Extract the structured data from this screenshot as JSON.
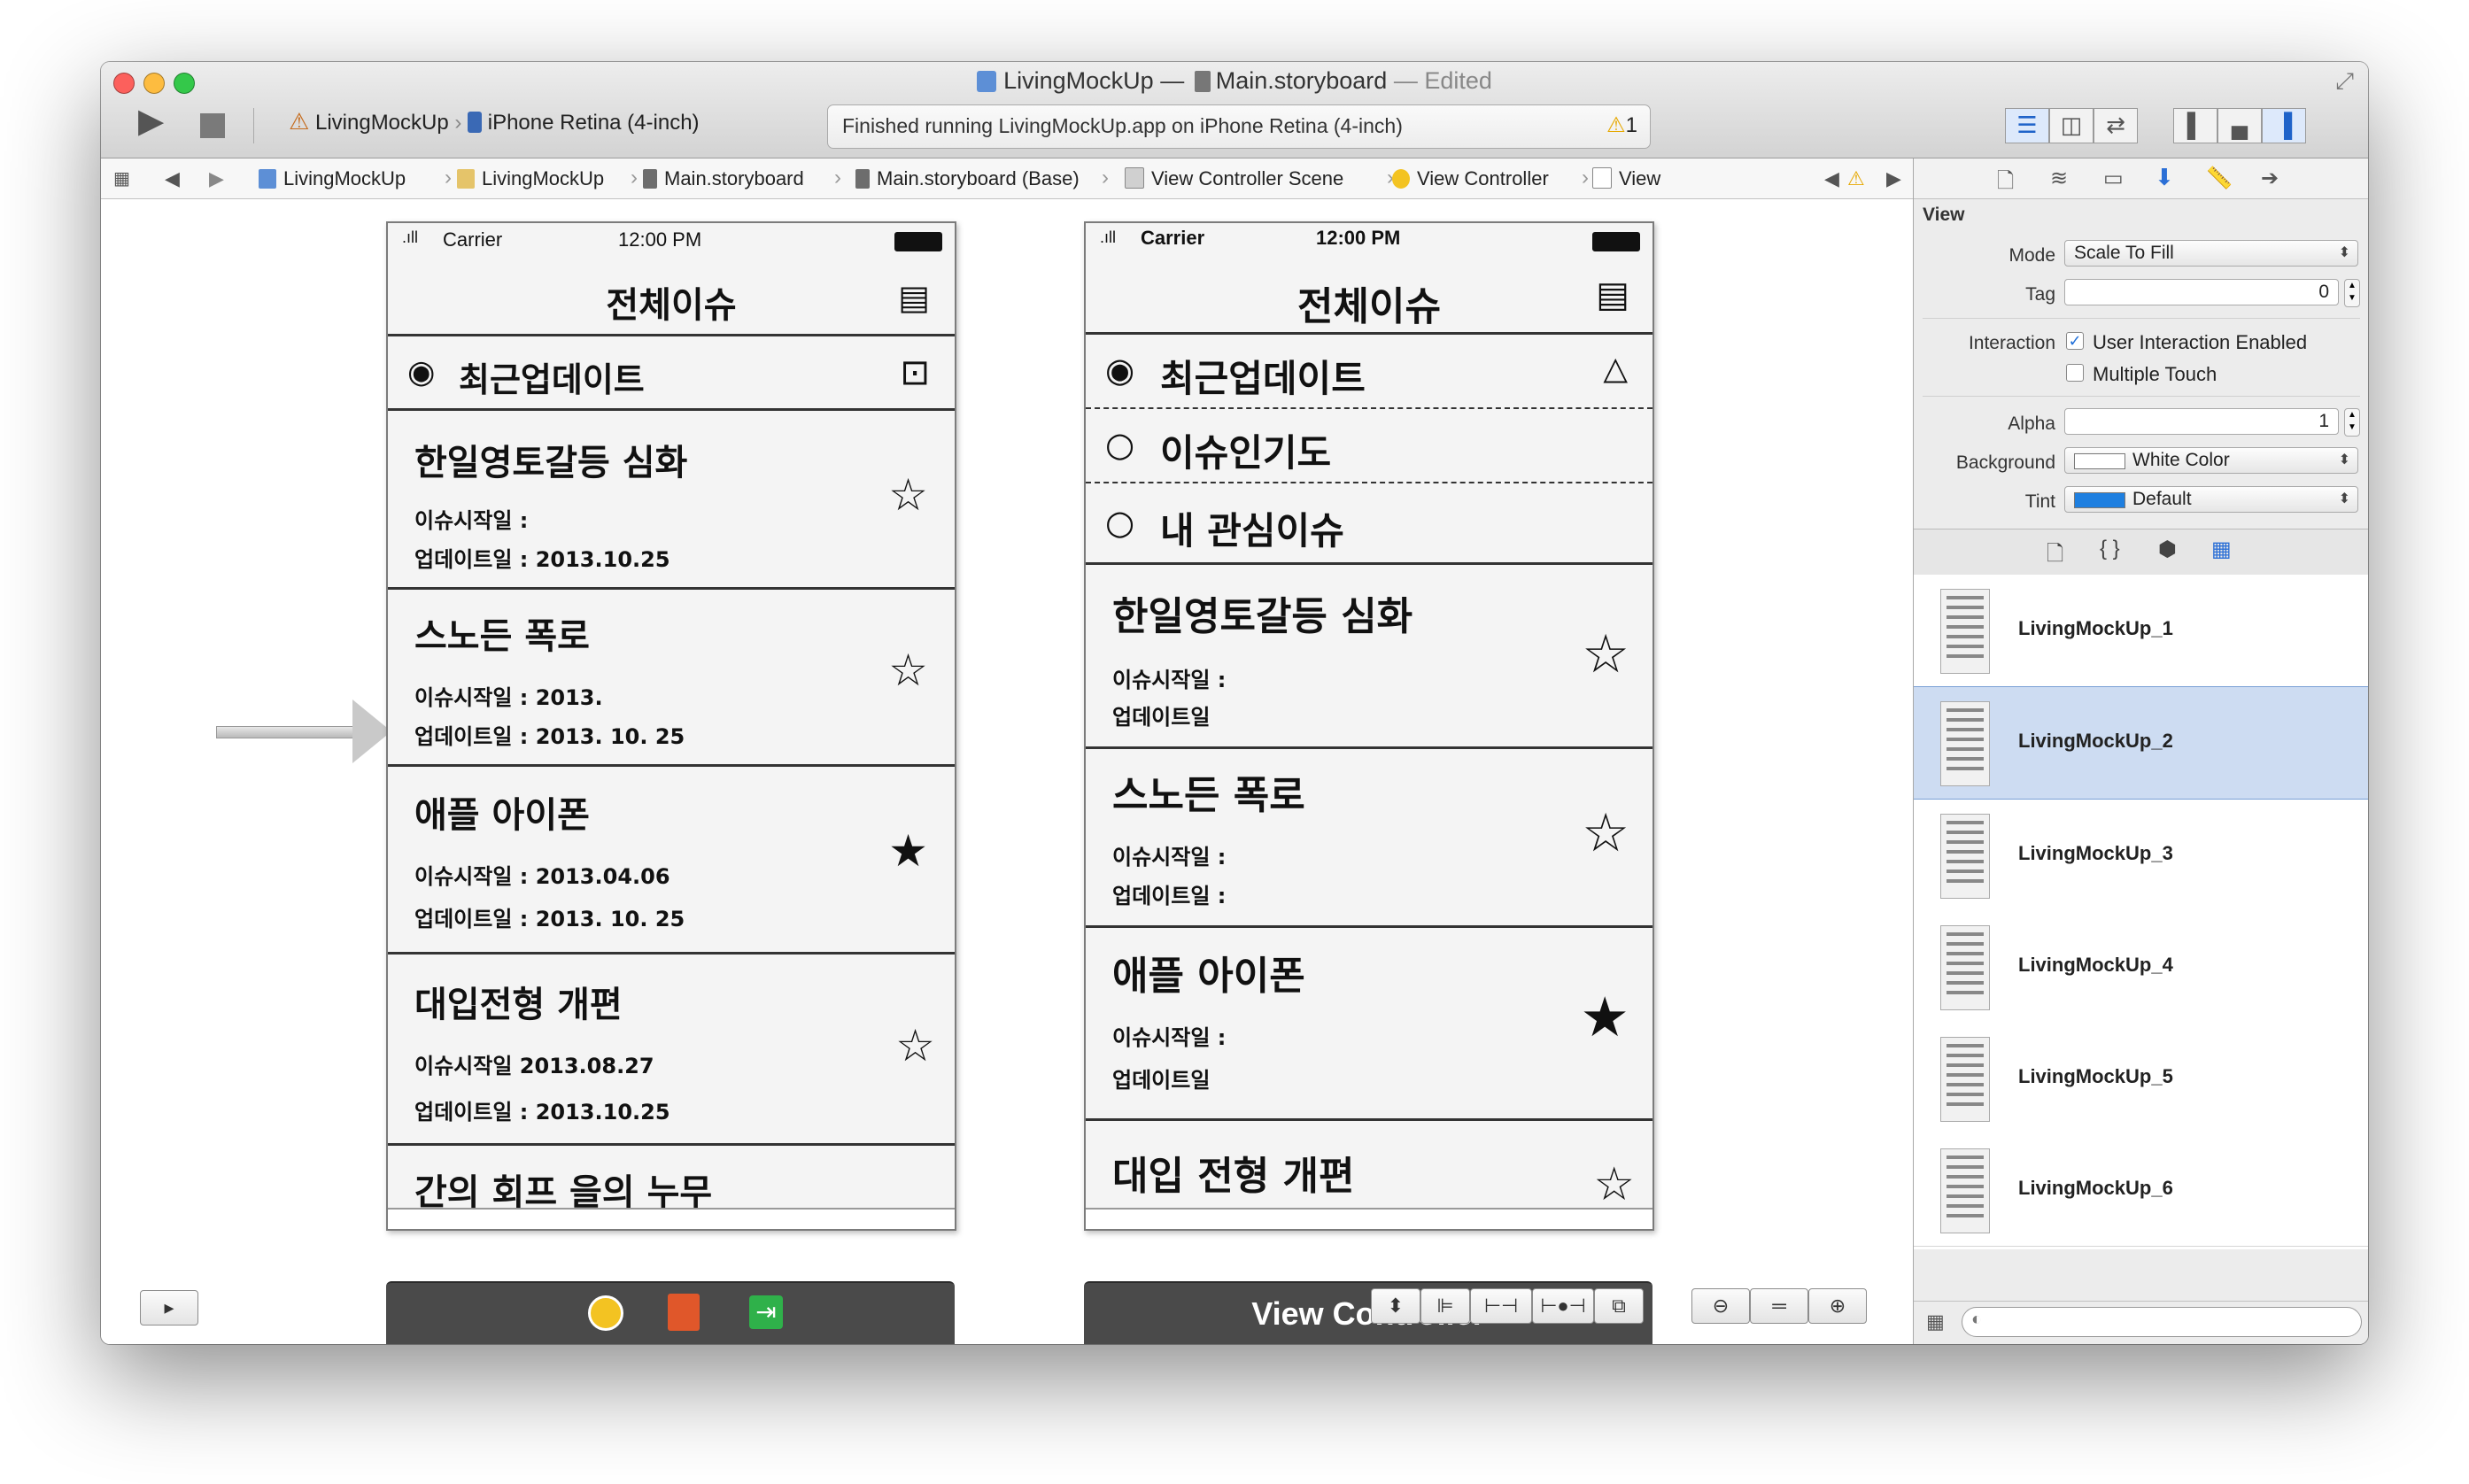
{
  "window": {
    "title": "LivingMockUp",
    "title_sep": "—",
    "file": "Main.storyboard",
    "state": "— Edited"
  },
  "toolbar": {
    "run_icon": "play-icon",
    "stop_icon": "stop-icon",
    "scheme": "LivingMockUp",
    "device": "iPhone Retina (4-inch)",
    "activity_message": "Finished running LivingMockUp.app on iPhone Retina (4-inch)",
    "warning_count": "1"
  },
  "jumpbar": {
    "crumbs": [
      "LivingMockUp",
      "LivingMockUp",
      "Main.storyboard",
      "Main.storyboard (Base)",
      "View Controller Scene",
      "View Controller",
      "View"
    ]
  },
  "mockup_left": {
    "status_carrier": "Carrier",
    "status_time": "12:00 PM",
    "header": "전체이슈",
    "filter": "최근업데이트",
    "items": [
      {
        "title": "한일영토갈등 심화",
        "line1": "이슈시작일 :",
        "line2": "업데이트일 : 2013.10.25",
        "starred": false
      },
      {
        "title": "스노든 폭로",
        "line1": "이슈시작일 : 2013.",
        "line2": "업데이트일 : 2013. 10. 25",
        "starred": false
      },
      {
        "title": "애플 아이폰",
        "line1": "이슈시작일 : 2013.04.06",
        "line2": "업데이트일 : 2013. 10. 25",
        "starred": true
      },
      {
        "title": "대입전형 개편",
        "line1": "이슈시작일 2013.08.27",
        "line2": "업데이트일 : 2013.10.25",
        "starred": false
      },
      {
        "title": "간의 회프 을의 누무",
        "line1": "",
        "line2": "",
        "starred": false
      }
    ]
  },
  "mockup_right": {
    "status_carrier": "Carrier",
    "status_time": "12:00 PM",
    "header": "전체이슈",
    "options": [
      "최근업데이트",
      "이슈인기도",
      "내 관심이슈"
    ],
    "items": [
      {
        "title": "한일영토갈등 심화",
        "line1": "이슈시작일 :",
        "line2": "업데이트일",
        "starred": false
      },
      {
        "title": "스노든 폭로",
        "line1": "이슈시작일 :",
        "line2": "업데이트일 :",
        "starred": false
      },
      {
        "title": "애플 아이폰",
        "line1": "이슈시작일 :",
        "line2": "업데이트일",
        "starred": true
      },
      {
        "title": "대입 전형 개편",
        "line1": "",
        "line2": "",
        "starred": false
      }
    ],
    "dock_label": "View Controller"
  },
  "inspector": {
    "section": "View",
    "mode_label": "Mode",
    "mode_value": "Scale To Fill",
    "tag_label": "Tag",
    "tag_value": "0",
    "interaction_label": "Interaction",
    "user_interaction": "User Interaction Enabled",
    "multiple_touch": "Multiple Touch",
    "alpha_label": "Alpha",
    "alpha_value": "1",
    "background_label": "Background",
    "background_value": "White Color",
    "tint_label": "Tint",
    "tint_value": "Default",
    "tint_color": "#1e7fe0",
    "selection_color": "#cddcf2"
  },
  "library": {
    "items": [
      "LivingMockUp_1",
      "LivingMockUp_2",
      "LivingMockUp_3",
      "LivingMockUp_4",
      "LivingMockUp_5",
      "LivingMockUp_6"
    ],
    "selected_index": 1
  }
}
